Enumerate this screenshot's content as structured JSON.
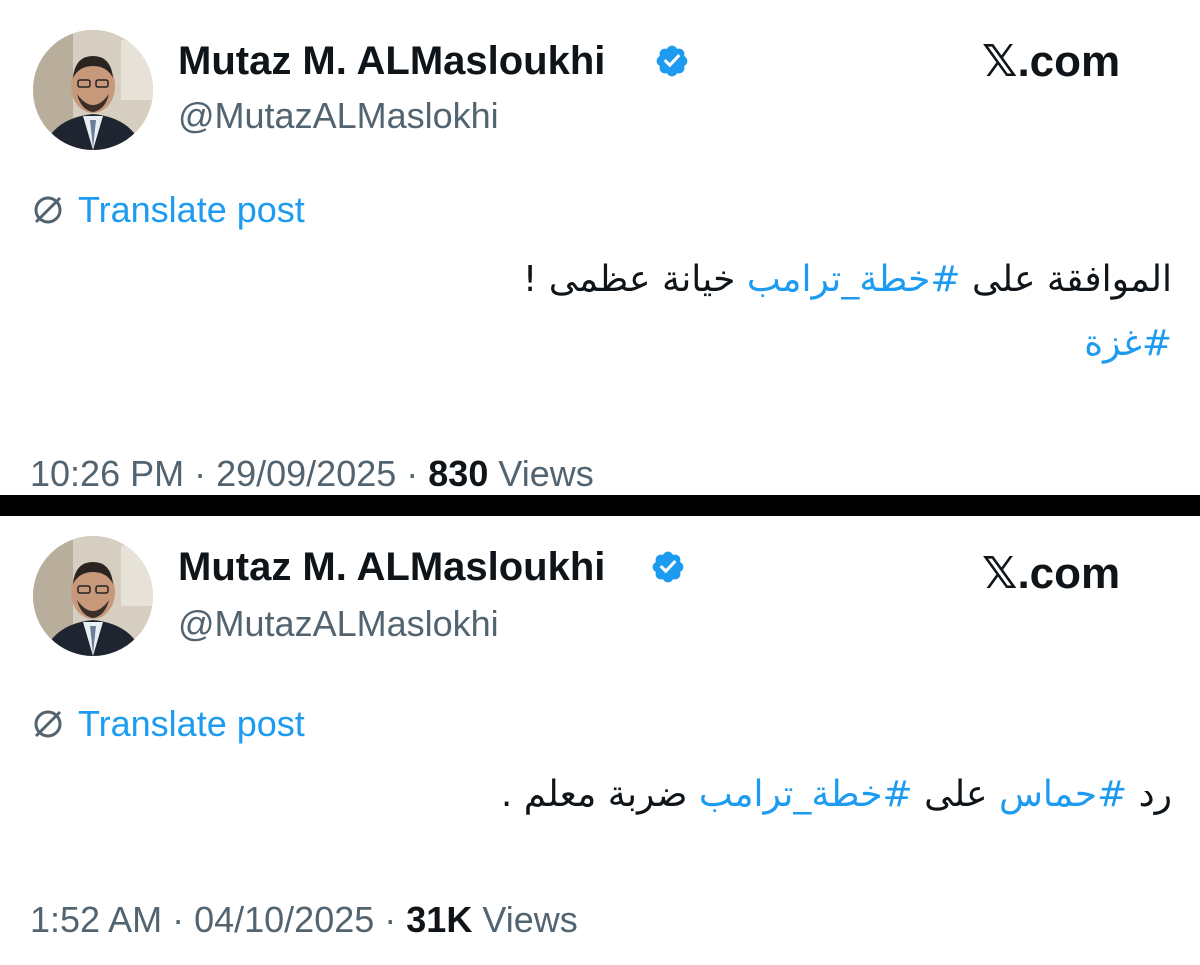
{
  "posts": [
    {
      "display_name": "Mutaz M. ALMasloukhi",
      "handle": "@MutazALMaslokhi",
      "site": "𝕏.com",
      "translate_label": "Translate post",
      "text": {
        "line1_prefix": "الموافقة على ",
        "line1_hashtag": "#خطة_ترامب",
        "line1_suffix": " خيانة عظمى !",
        "line2_hashtag": "#غزة"
      },
      "time": "10:26 PM",
      "date": "29/09/2025",
      "views_count": "830",
      "views_label": "Views"
    },
    {
      "display_name": "Mutaz M. ALMasloukhi",
      "handle": "@MutazALMaslokhi",
      "site": "𝕏.com",
      "translate_label": "Translate post",
      "text": {
        "line1_prefix": "رد ",
        "line1_hashtag_a": "#حماس",
        "line1_middle": " على ",
        "line1_hashtag_b": "#خطة_ترامب",
        "line1_suffix": " ضربة معلم ."
      },
      "time": "1:52 AM",
      "date": "04/10/2025",
      "views_count": "31K",
      "views_label": "Views"
    }
  ],
  "meta_separator": " · ",
  "colors": {
    "accent": "#1d9bf0",
    "text": "#0f1419",
    "secondary": "#536471",
    "badge": "#1d9bf0",
    "separator": "#000000"
  },
  "icons": {
    "verified": "verified-badge-icon",
    "translate": "globe-slash-icon",
    "logo": "x-logo"
  }
}
